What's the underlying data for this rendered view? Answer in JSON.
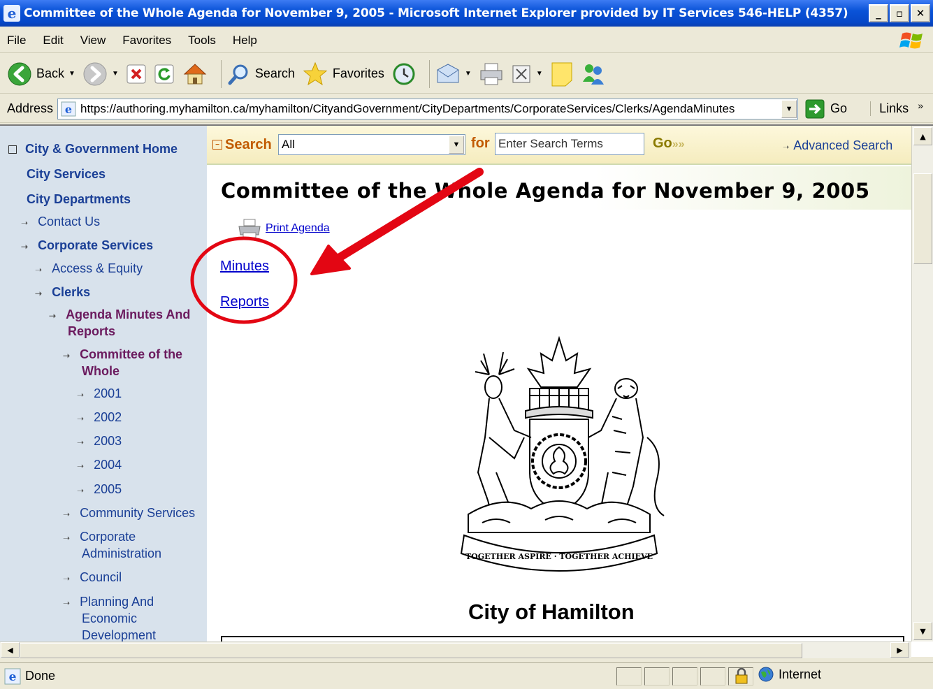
{
  "window": {
    "title": "Committee of the Whole Agenda for November 9, 2005 - Microsoft Internet Explorer provided by IT Services  546-HELP (4357)",
    "minimize": "_",
    "maximize": "▫",
    "close": "✕"
  },
  "menubar": {
    "items": [
      "File",
      "Edit",
      "View",
      "Favorites",
      "Tools",
      "Help"
    ]
  },
  "toolbar": {
    "back_label": "Back",
    "search_label": "Search",
    "favorites_label": "Favorites"
  },
  "addressbar": {
    "label": "Address",
    "url": "https://authoring.myhamilton.ca/myhamilton/CityandGovernment/CityDepartments/CorporateServices/Clerks/AgendaMinutes",
    "go_label": "Go",
    "links_label": "Links",
    "links_chevron": "»"
  },
  "sidebar": {
    "home": "City & Government Home",
    "city_services": "City Services",
    "city_departments": "City Departments",
    "contact_us": "Contact Us",
    "corporate_services": "Corporate Services",
    "access_equity": "Access & Equity",
    "clerks": "Clerks",
    "agenda_line1": "Agenda Minutes And",
    "agenda_line2": "Reports",
    "cotw_line1": "Committee of the",
    "cotw_line2": "Whole",
    "years": [
      "2001",
      "2002",
      "2003",
      "2004",
      "2005"
    ],
    "community_services": "Community Services",
    "corp_admin_line1": "Corporate",
    "corp_admin_line2": "Administration",
    "council": "Council",
    "planning_line1": "Planning And",
    "planning_line2": "Economic",
    "planning_line3": "Development"
  },
  "search": {
    "label": "Search",
    "scope_value": "All",
    "for_label": "for",
    "input_value": "Enter Search Terms",
    "go_label": "Go",
    "advanced_label": "Advanced Search"
  },
  "page": {
    "title": "Committee of the Whole Agenda for November 9, 2005",
    "print_agenda": "Print Agenda",
    "minutes_link": "Minutes",
    "reports_link": "Reports",
    "crest_motto": "TOGETHER ASPIRE · TOGETHER ACHIEVE",
    "city_name": "City of Hamilton"
  },
  "status": {
    "text": "Done",
    "zone": "Internet"
  },
  "colors": {
    "annotation": "#e30613",
    "link": "#0000cc",
    "nav": "#1a3f96",
    "nav_active": "#6b1a5e",
    "search_label": "#c15a00",
    "sidebar_bg": "#d8e2ec"
  }
}
